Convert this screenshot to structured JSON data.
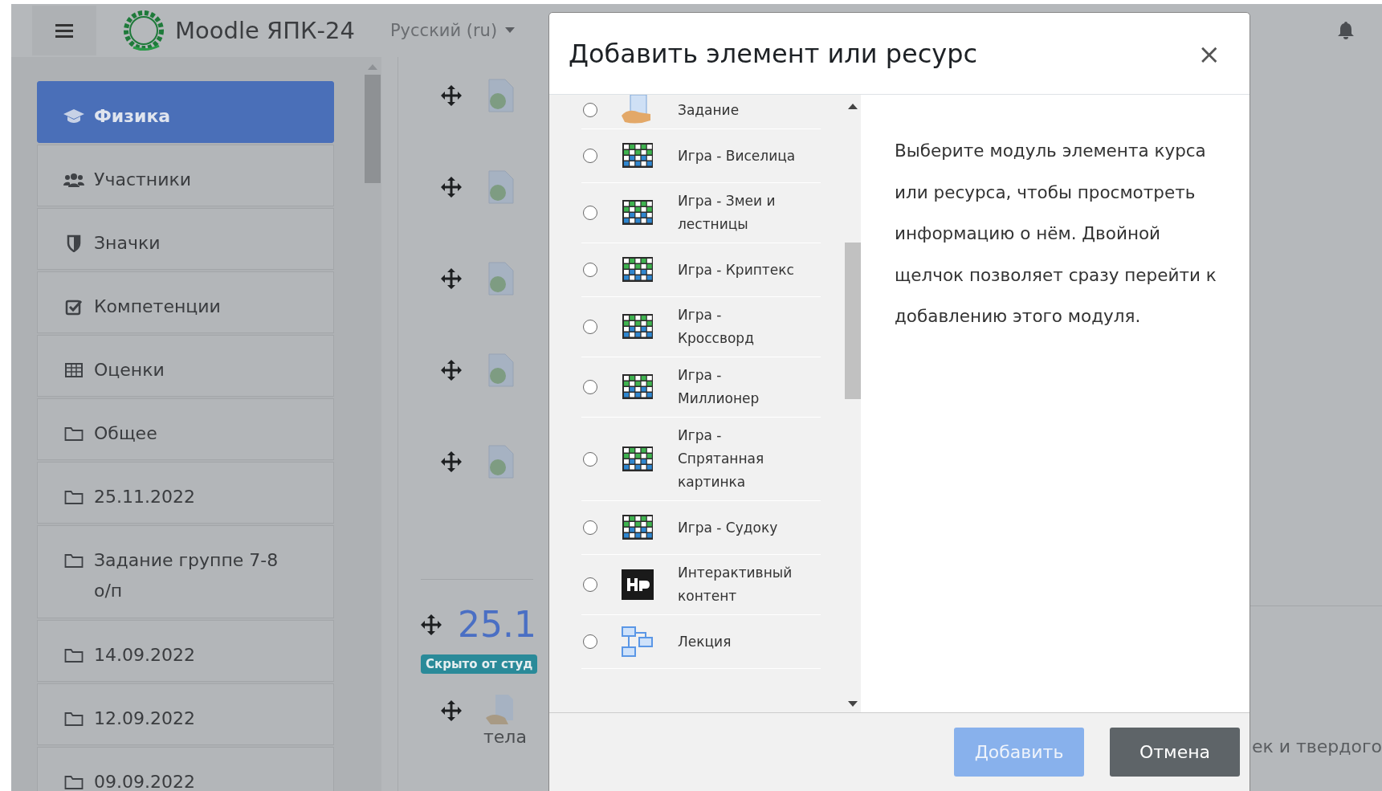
{
  "header": {
    "site_name": "Moodle ЯПК-24",
    "language": "Русский (ru)"
  },
  "sidebar": {
    "items": [
      {
        "label": "Физика",
        "kind": "course",
        "selected": true
      },
      {
        "label": "Участники",
        "kind": "users",
        "selected": false
      },
      {
        "label": "Значки",
        "kind": "badges",
        "selected": false
      },
      {
        "label": "Компетенции",
        "kind": "competencies",
        "selected": false
      },
      {
        "label": "Оценки",
        "kind": "grades",
        "selected": false
      },
      {
        "label": "Общее",
        "kind": "section",
        "selected": false
      },
      {
        "label": "25.11.2022",
        "kind": "section",
        "selected": false
      },
      {
        "label": "Задание группе 7-8 о/п",
        "kind": "section",
        "selected": false
      },
      {
        "label": "14.09.2022",
        "kind": "section",
        "selected": false
      },
      {
        "label": "12.09.2022",
        "kind": "section",
        "selected": false
      },
      {
        "label": "09.09.2022",
        "kind": "section",
        "selected": false
      }
    ]
  },
  "content": {
    "section_title": "25.1",
    "badge": "Скрыто от студ",
    "activity_text": "тела",
    "right_text": "ек и твердого"
  },
  "modal": {
    "title": "Добавить элемент или ресурс",
    "close": "×",
    "options": [
      {
        "label": "Задание",
        "kind": "assignment",
        "selected": false
      },
      {
        "label": "Игра - Виселица",
        "kind": "game",
        "selected": false
      },
      {
        "label": "Игра - Змеи и лестницы",
        "kind": "game",
        "selected": false
      },
      {
        "label": "Игра - Криптекс",
        "kind": "game",
        "selected": false
      },
      {
        "label": "Игра - Кроссворд",
        "kind": "game",
        "selected": false
      },
      {
        "label": "Игра - Миллионер",
        "kind": "game",
        "selected": false
      },
      {
        "label": "Игра - Спрятанная картинка",
        "kind": "game",
        "selected": false
      },
      {
        "label": "Игра - Судоку",
        "kind": "game",
        "selected": false
      },
      {
        "label": "Интерактивный контент",
        "kind": "h5p",
        "selected": false
      },
      {
        "label": "Лекция",
        "kind": "lesson",
        "selected": false
      }
    ],
    "description": "Выберите модуль элемента курса или ресурса, чтобы просмотреть информацию о нём. Двойной щелчок позволяет сразу перейти к добавлению этого модуля.",
    "buttons": [
      {
        "label": "Добавить",
        "kind": "primary",
        "disabled": true
      },
      {
        "label": "Отмена",
        "kind": "secondary",
        "disabled": false
      }
    ]
  }
}
